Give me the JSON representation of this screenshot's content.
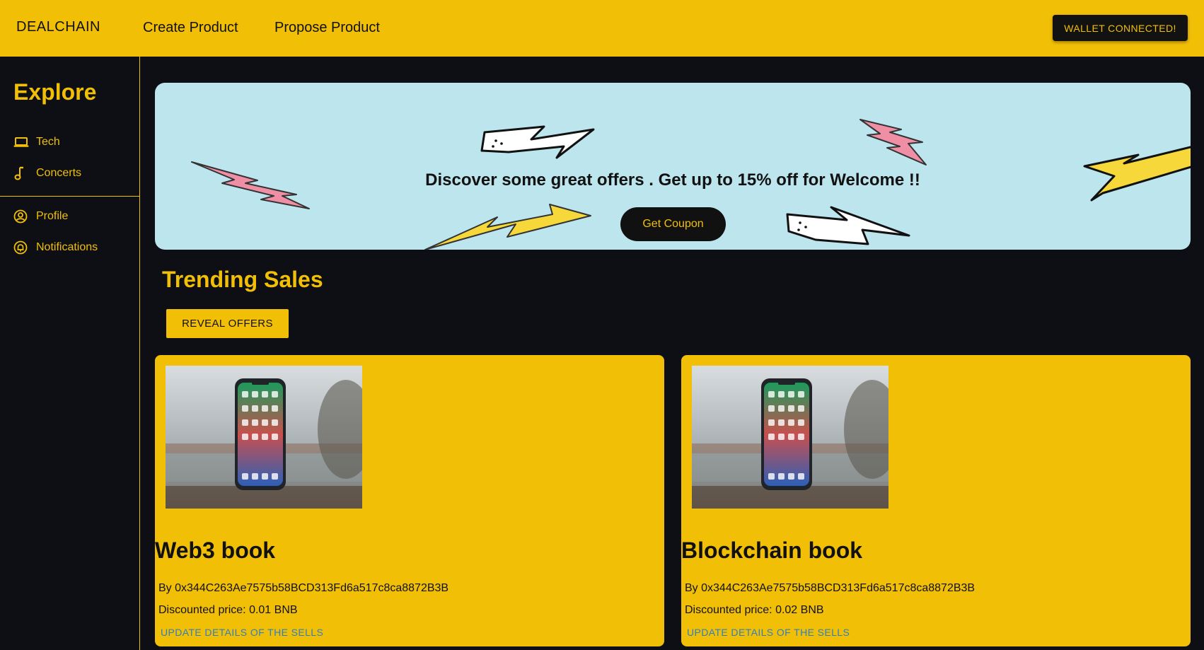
{
  "navbar": {
    "brand": "DEALCHAIN",
    "links": [
      "Create Product",
      "Propose Product"
    ],
    "wallet_button": "WALLET CONNECTED!"
  },
  "sidebar": {
    "title": "Explore",
    "items": [
      {
        "label": "Tech",
        "icon": "laptop-icon"
      },
      {
        "label": "Concerts",
        "icon": "music-note-icon"
      },
      {
        "label": "Profile",
        "icon": "user-circle-icon"
      },
      {
        "label": "Notifications",
        "icon": "bell-circle-icon"
      }
    ]
  },
  "banner": {
    "text": "Discover some great offers . Get up to 15% off for Welcome !!",
    "button": "Get Coupon"
  },
  "trending": {
    "title": "Trending Sales",
    "reveal_button": "REVEAL OFFERS"
  },
  "cards": [
    {
      "title": "Web3 book",
      "by": "By 0x344C263Ae7575b58BCD313Fd6a517c8ca8872B3B",
      "price": "Discounted price: 0.01 BNB",
      "link": "UPDATE DETAILS OF THE SELLS"
    },
    {
      "title": "Blockchain book",
      "by": "By 0x344C263Ae7575b58BCD313Fd6a517c8ca8872B3B",
      "price": "Discounted price: 0.02 BNB",
      "link": "UPDATE DETAILS OF THE SELLS"
    }
  ],
  "colors": {
    "accent": "#f2bf07",
    "background": "#0d0f14",
    "banner": "#bde5ee",
    "link": "#2d7fc1"
  }
}
